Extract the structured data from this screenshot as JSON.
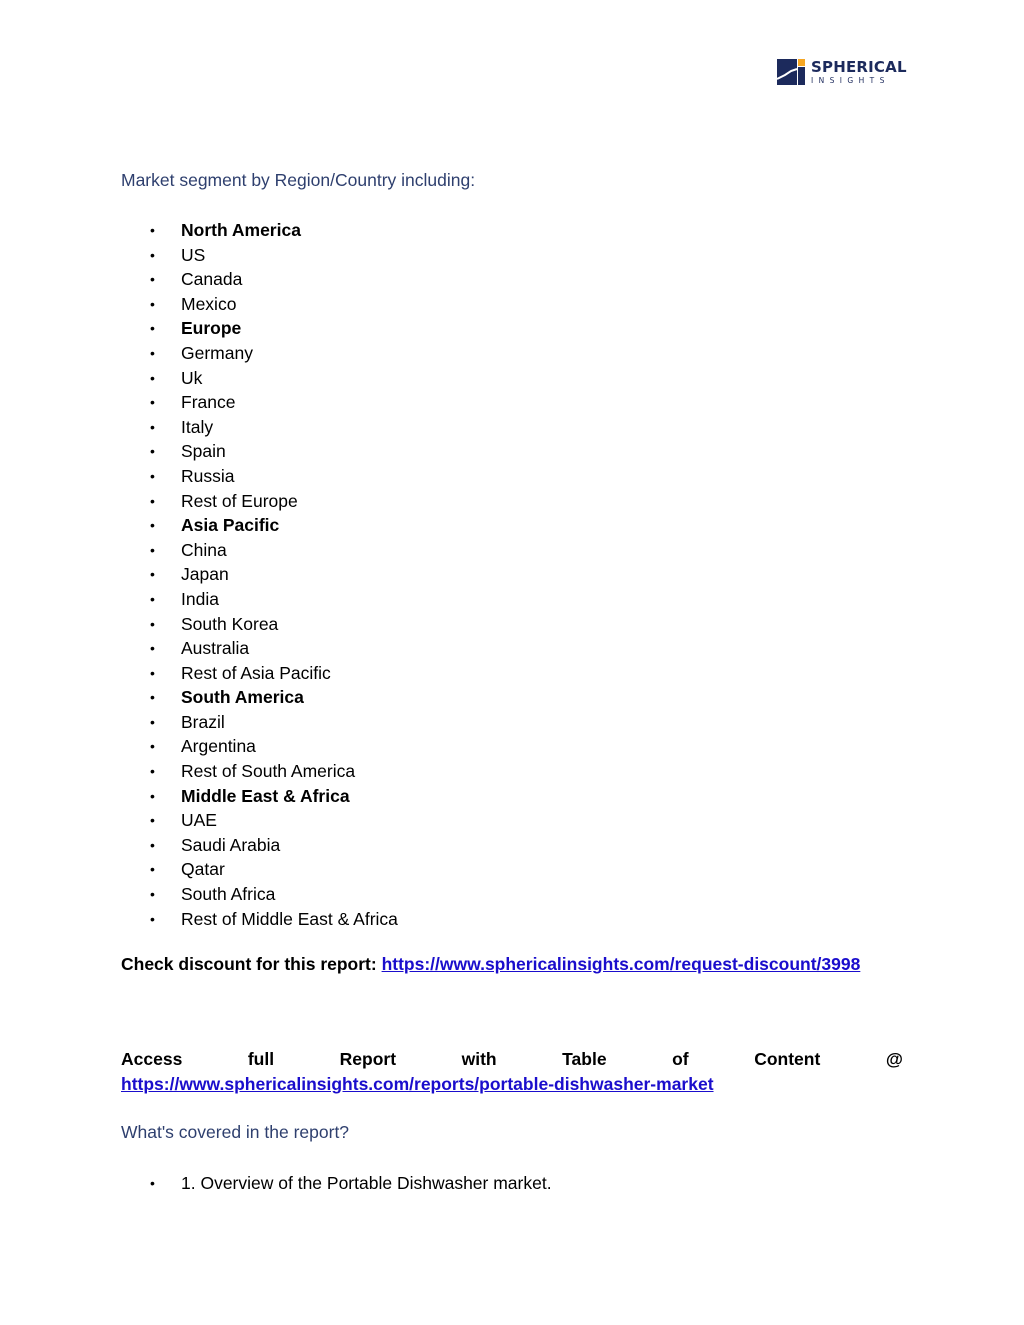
{
  "logo": {
    "title": "SPHERICAL",
    "subtitle": "INSIGHTS",
    "colors": {
      "navy": "#1c2a5c",
      "accent": "#f5a623"
    }
  },
  "segment_heading": "Market segment by Region/Country including:",
  "regions": [
    {
      "label": "North America",
      "bold": true
    },
    {
      "label": "US",
      "bold": false
    },
    {
      "label": "Canada",
      "bold": false
    },
    {
      "label": "Mexico",
      "bold": false
    },
    {
      "label": "Europe",
      "bold": true
    },
    {
      "label": "Germany",
      "bold": false
    },
    {
      "label": "Uk",
      "bold": false
    },
    {
      "label": "France",
      "bold": false
    },
    {
      "label": "Italy",
      "bold": false
    },
    {
      "label": "Spain",
      "bold": false
    },
    {
      "label": "Russia",
      "bold": false
    },
    {
      "label": "Rest of Europe",
      "bold": false
    },
    {
      "label": "Asia Pacific",
      "bold": true
    },
    {
      "label": "China",
      "bold": false
    },
    {
      "label": "Japan",
      "bold": false
    },
    {
      "label": "India",
      "bold": false
    },
    {
      "label": "South Korea",
      "bold": false
    },
    {
      "label": "Australia",
      "bold": false
    },
    {
      "label": "Rest of Asia Pacific",
      "bold": false
    },
    {
      "label": "South America",
      "bold": true
    },
    {
      "label": "Brazil",
      "bold": false
    },
    {
      "label": "Argentina",
      "bold": false
    },
    {
      "label": "Rest of South America",
      "bold": false
    },
    {
      "label": "Middle East & Africa",
      "bold": true
    },
    {
      "label": "UAE",
      "bold": false
    },
    {
      "label": "Saudi Arabia",
      "bold": false
    },
    {
      "label": "Qatar",
      "bold": false
    },
    {
      "label": "South Africa",
      "bold": false
    },
    {
      "label": "Rest of Middle East & Africa",
      "bold": false
    }
  ],
  "discount": {
    "label": "Check discount for this report: ",
    "url": "https://www.sphericalinsights.com/request-discount/3998"
  },
  "access": {
    "words": [
      "Access",
      "full",
      "Report",
      "with",
      "Table",
      "of",
      "Content",
      "@"
    ],
    "url": "https://www.sphericalinsights.com/reports/portable-dishwasher-market"
  },
  "covered_heading": "What's covered in the report?",
  "covered_items": [
    "1. Overview of the Portable Dishwasher market."
  ],
  "bullet_char": "•"
}
